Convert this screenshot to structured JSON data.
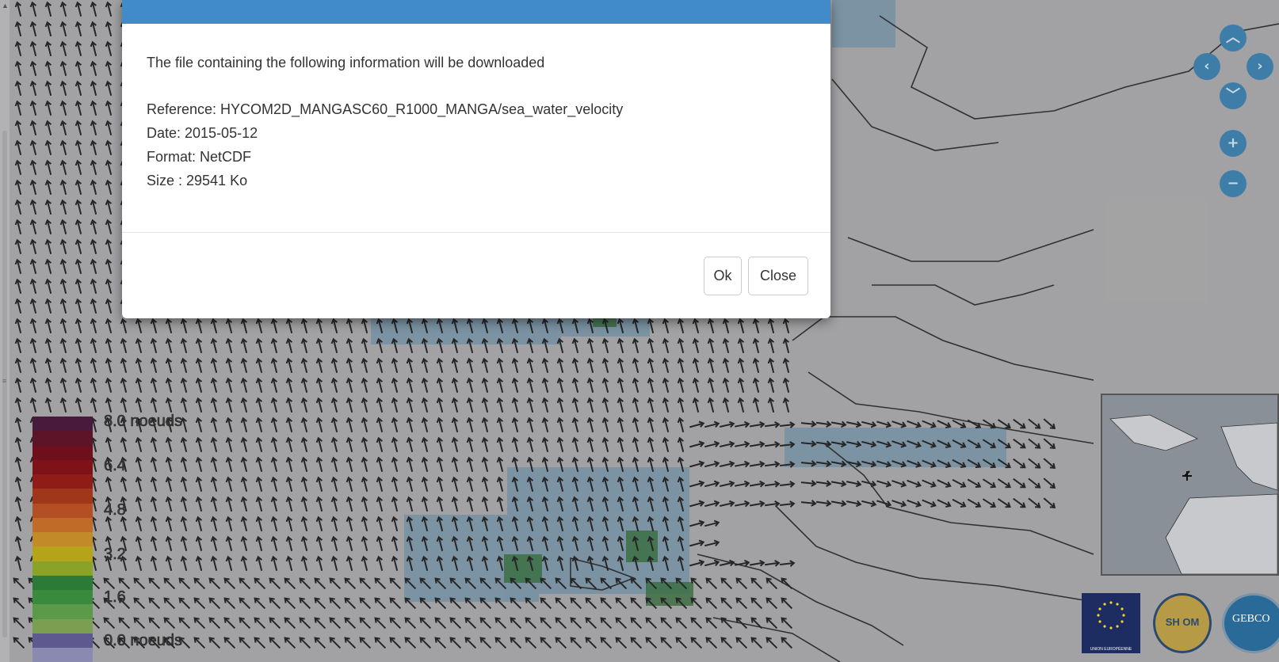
{
  "modal": {
    "intro": "The file containing the following information will be downloaded",
    "reference": "Reference: HYCOM2D_MANGASC60_R1000_MANGA/sea_water_velocity",
    "date": "Date: 2015-05-12",
    "format": "Format: NetCDF",
    "size": "Size : 29541 Ko",
    "ok_label": "Ok",
    "close_label": "Close",
    "header_color": "#428bca"
  },
  "map_controls": {
    "pan_up_icon": "chevron-up-icon",
    "pan_left_icon": "chevron-left-icon",
    "pan_right_icon": "chevron-right-icon",
    "pan_down_icon": "chevron-down-icon",
    "zoom_in_icon": "plus-icon",
    "zoom_out_icon": "minus-icon"
  },
  "legend": {
    "labels": [
      "8.0 noeuds",
      "6.4",
      "4.8",
      "3.2",
      "1.6",
      "0.0 noeuds"
    ],
    "colors": [
      "#4a1a3c",
      "#5e1428",
      "#6e0f1c",
      "#7e1218",
      "#8f1c16",
      "#a0361a",
      "#b44e24",
      "#c06b28",
      "#c38a28",
      "#b4a419",
      "#8aa227",
      "#2d7a38",
      "#3a8a3e",
      "#5a9a48",
      "#7c9e50",
      "#5e5a90",
      "#8a8ab0"
    ]
  },
  "logos": {
    "eu_caption": "UNION EUROPÉENNE",
    "shom_text": "SH OM",
    "gebco_text": "GEBCO"
  }
}
